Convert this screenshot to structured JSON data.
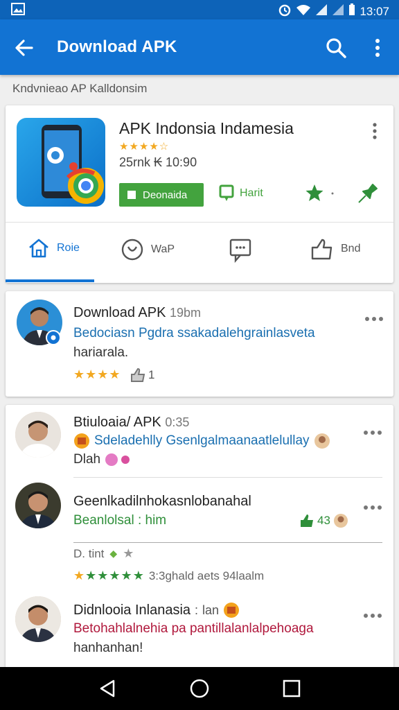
{
  "status_bar": {
    "time": "13:07",
    "icons": [
      "gallery-icon",
      "alarm-icon",
      "wifi-icon",
      "signal-icon",
      "signal-icon",
      "battery-icon"
    ]
  },
  "app_bar": {
    "title": "Download APK",
    "icons": [
      "back-arrow-icon",
      "search-icon",
      "more-vert-icon"
    ]
  },
  "section_label": "Kndvnieao AP Kalldonsim",
  "app_card": {
    "title": "APK Indonsia Indamesia",
    "rating_stars": "★★★★☆",
    "meta": "25rnk ₭ 10:90",
    "download_label": "Deonaida",
    "mark_label": "Harit",
    "actions": [
      "star-icon",
      "pin-icon"
    ],
    "tabs": [
      {
        "label": "Roie",
        "icon": "home-icon"
      },
      {
        "label": "WaP",
        "icon": "chat-icon"
      },
      {
        "label": "",
        "icon": "message-icon"
      },
      {
        "label": "Bnd",
        "icon": "thumb-up-icon"
      }
    ],
    "colors": {
      "primary": "#1273d3",
      "accent": "#43a33e"
    }
  },
  "posts": [
    {
      "title": "Download APK",
      "time": "19bm",
      "text_line1": "Bedociasn Pgdra ssakadalehgrainlasveta",
      "text_line2": "hariarala.",
      "stars": "★★★★",
      "likes": "1"
    },
    {
      "title": "Btiuloaia/ APK",
      "time": "0:35",
      "text_line1": "Sdeladehlly Gsenlgalmaanaatlelullay",
      "text_line2": "Dlah"
    },
    {
      "title": "Geenlkadilnhokasnlobanahal",
      "text_line1": "Beanlolsal : him",
      "likes": "43",
      "footer_text": "D. tint",
      "footer_stars": "★★★★★",
      "footer_meta": "3:3ghald aets 94laalm"
    },
    {
      "title": "Didnlooia Inlanasia",
      "time": "lan",
      "text_line1": "Betohahlalnehia pa pantillalanlalpehoaga",
      "text_line2": "hanhanhan!"
    }
  ]
}
